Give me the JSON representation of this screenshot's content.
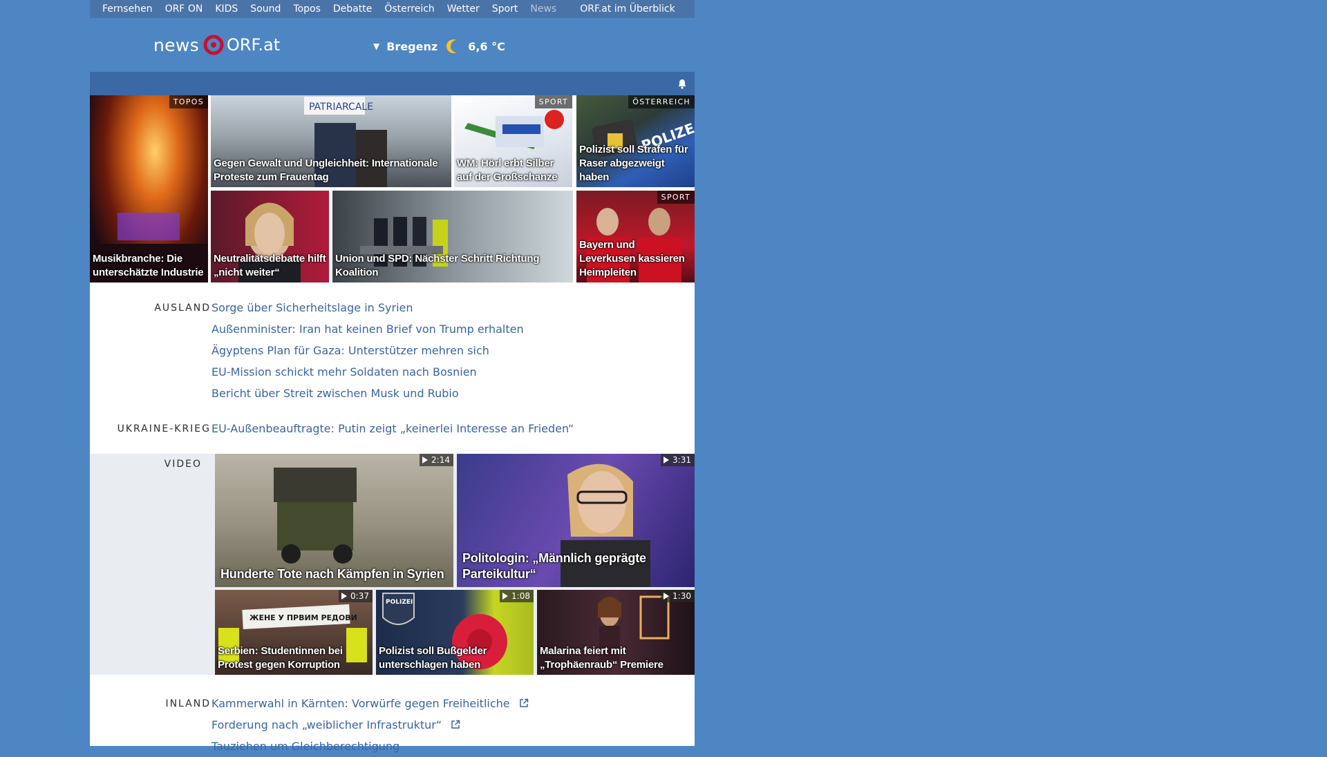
{
  "topnav": {
    "items": [
      "Fernsehen",
      "ORF ON",
      "KIDS",
      "Sound",
      "Topos",
      "Debatte",
      "Österreich",
      "Wetter",
      "Sport",
      "News"
    ],
    "overview": "ORF.at im Überblick"
  },
  "header": {
    "logo_news": "news",
    "logo_orf": "ORF.at",
    "city": "Bregenz",
    "temperature": "6,6 °C"
  },
  "colors": {
    "page_bg": "#4e86c4",
    "nav_bg": "#4a73a8",
    "bar_bg": "#3b69a6",
    "link": "#3a64a3",
    "orf_red": "#c8102e"
  },
  "teasers": [
    {
      "category": "TOPOS",
      "title": "Musikbranche: Die unterschätzte Industrie"
    },
    {
      "category": "",
      "title": "Gegen Gewalt und Ungleichheit: Internationale Proteste zum Frauentag"
    },
    {
      "category": "SPORT",
      "title": "WM: Hörl erbt Silber auf der Großschanze"
    },
    {
      "category": "ÖSTERREICH",
      "title": "Polizist soll Strafen für Raser abgezweigt haben"
    },
    {
      "category": "",
      "title": "Neutralitätsdebatte hilft „nicht weiter“"
    },
    {
      "category": "",
      "title": "Union und SPD: Nächster Schritt Richtung Koalition"
    },
    {
      "category": "SPORT",
      "title": "Bayern und Leverkusen kassieren Heimpleiten"
    }
  ],
  "sections": {
    "ausland": {
      "label": "AUSLAND",
      "links": [
        "Sorge über Sicherheitslage in Syrien",
        "Außenminister: Iran hat keinen Brief von Trump erhalten",
        "Ägyptens Plan für Gaza: Unterstützer mehren sich",
        "EU-Mission schickt mehr Soldaten nach Bosnien",
        "Bericht über Streit zwischen Musk und Rubio"
      ]
    },
    "ukraine": {
      "label": "UKRAINE-KRIEG",
      "links": [
        "EU-Außenbeauftragte: Putin zeigt „keinerlei Interesse an Frieden“"
      ]
    },
    "video": {
      "label": "VIDEO",
      "items": [
        {
          "duration": "2:14",
          "title": "Hunderte Tote nach Kämpfen in Syrien"
        },
        {
          "duration": "3:31",
          "title": "Politologin: „Männlich geprägte Parteikultur“"
        },
        {
          "duration": "0:37",
          "title": "Serbien: Studentinnen bei Protest gegen Korruption"
        },
        {
          "duration": "1:08",
          "title": "Polizist soll Bußgelder unterschlagen haben"
        },
        {
          "duration": "1:30",
          "title": "Malarina feiert mit „Trophäenraub“ Premiere"
        }
      ]
    },
    "inland": {
      "label": "INLAND",
      "links": [
        "Kammerwahl in Kärnten: Vorwürfe gegen Freiheitliche",
        "Forderung nach „weiblicher Infrastruktur“",
        "Tauziehen um Gleichberechtigung"
      ]
    }
  }
}
